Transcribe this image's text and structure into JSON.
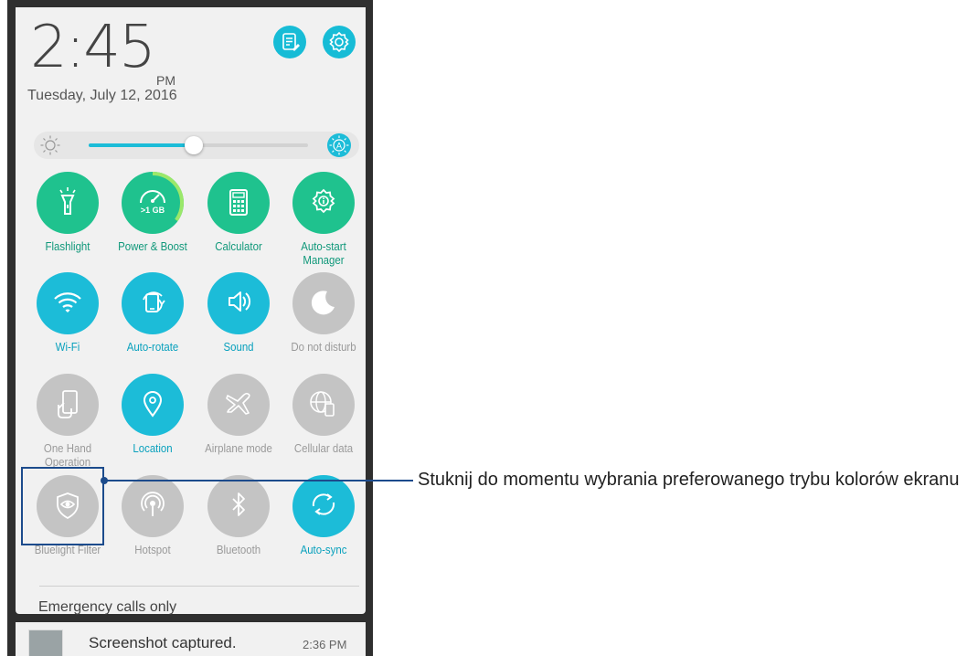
{
  "status": {
    "time_hours_minutes": "2:45",
    "ampm": "PM",
    "date": "Tuesday, July 12, 2016"
  },
  "top_actions": [
    {
      "name": "notes-icon"
    },
    {
      "name": "settings-icon"
    }
  ],
  "brightness": {
    "level_fraction": 0.48,
    "auto_label": "A"
  },
  "colors": {
    "active": "#1cbcd8",
    "green": "#1fc28e",
    "inactive": "#c4c4c4",
    "callout": "#1c4b8c"
  },
  "quick_settings": [
    {
      "label": "Flashlight",
      "icon": "flashlight-icon",
      "state": "green"
    },
    {
      "label": "Power & Boost",
      "icon": "speedometer-icon",
      "state": "green",
      "sub": ">1 GB",
      "boost_level_fraction": 0.35
    },
    {
      "label": "Calculator",
      "icon": "calculator-icon",
      "state": "green"
    },
    {
      "label": "Auto-start\nManager",
      "icon": "gear-info-icon",
      "state": "green"
    },
    {
      "label": "Wi-Fi",
      "icon": "wifi-icon",
      "state": "active"
    },
    {
      "label": "Auto-rotate",
      "icon": "rotate-icon",
      "state": "active"
    },
    {
      "label": "Sound",
      "icon": "speaker-icon",
      "state": "active"
    },
    {
      "label": "Do not disturb",
      "icon": "moon-icon",
      "state": "off"
    },
    {
      "label": "One Hand\nOperation",
      "icon": "one-hand-icon",
      "state": "off"
    },
    {
      "label": "Location",
      "icon": "location-pin-icon",
      "state": "active"
    },
    {
      "label": "Airplane mode",
      "icon": "airplane-icon",
      "state": "off"
    },
    {
      "label": "Cellular data",
      "icon": "cellular-data-icon",
      "state": "off"
    },
    {
      "label": "Bluelight Filter",
      "icon": "eye-shield-icon",
      "state": "off"
    },
    {
      "label": "Hotspot",
      "icon": "hotspot-icon",
      "state": "off"
    },
    {
      "label": "Bluetooth",
      "icon": "bluetooth-icon",
      "state": "off"
    },
    {
      "label": "Auto-sync",
      "icon": "sync-icon",
      "state": "active"
    }
  ],
  "emergency_text": "Emergency calls only",
  "notification": {
    "title": "Screenshot captured.",
    "time": "2:36 PM"
  },
  "callout": "Stuknij do momentu wybrania preferowanego trybu kolorów ekranu"
}
